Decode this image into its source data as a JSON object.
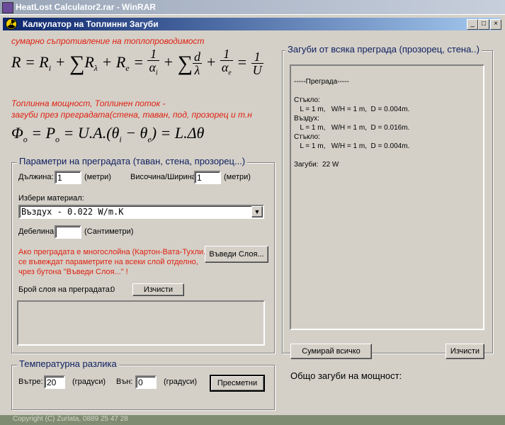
{
  "outer_window": {
    "title": "HeatLost Calculator2.rar - WinRAR"
  },
  "window": {
    "title": "Калкулатор на Топлинни Загуби",
    "min_label": "_",
    "max_label": "□",
    "close_label": "×"
  },
  "header": {
    "resistance_note": "сумарно съпротивление на топлопроводимост",
    "power_note_1": "Топлинна мощност, Топлинен поток -",
    "power_note_2": "загуби през преградата(стена, таван, под, прозорец и т.н"
  },
  "formula1": {
    "lhs": "R = R",
    "sub_i": "i",
    "plus1": " + ",
    "sum": "∑",
    "r_lambda": "R",
    "sub_lambda": "λ",
    "plus2": " + R",
    "sub_e": "e",
    "eq": " = ",
    "f1_num": "1",
    "f1_den": "α",
    "f1_den_sub": "i",
    "plus3": " + ",
    "sum2": "∑",
    "f2_num": "d",
    "f2_den": "λ",
    "plus4": " + ",
    "f3_num": "1",
    "f3_den": "α",
    "f3_den_sub": "e",
    "eq2": " = ",
    "f4_num": "1",
    "f4_den": "U"
  },
  "formula2": {
    "text": "Φ",
    "sub_o": "o",
    "mid": " = P",
    "sub_o2": "o",
    "rest": " = U.A.(θ",
    "sub_i": "i",
    "minus": " − θ",
    "sub_e": "e",
    "end": ") = L.Δθ"
  },
  "params": {
    "legend": "Параметри на преградата (таван, стена, прозорец...)",
    "length_label": "Дължина:",
    "length_value": "1",
    "length_unit": "(метри)",
    "height_label": "Височина/Ширина:",
    "height_value": "1",
    "height_unit": "(метри)",
    "material_label": "Избери материал:",
    "material_value": "Въздух                    - 0.022 W/m.K",
    "thickness_label": "Дебелина:",
    "thickness_value": "",
    "thickness_unit": "(Сантиметри)",
    "multilayer_note_1": "Ако преградата е многослойна (Картон-Вата-Тухли...)",
    "multilayer_note_2": "се въвеждат параметрите на всеки слой  отделно,",
    "multilayer_note_3": "чрез бутона \"Въведи Слоя...\" !",
    "enter_layer_button": "Въведи Слоя...",
    "layer_count_label": "Брой слоя на преградата:",
    "layer_count_value": "0",
    "clear_button": "Изчисти"
  },
  "temperature": {
    "legend": "Температурна разлика",
    "inside_label": "Вътре:",
    "inside_value": "20",
    "inside_unit": "(градуси)",
    "outside_label": "Вън:",
    "outside_value": "0",
    "outside_unit": "(градуси)",
    "calculate_button": "Пресметни"
  },
  "losses": {
    "legend": "Загуби от всяка преграда (прозорец, стена..)",
    "lines": [
      "-----Преграда-----",
      "",
      "Стъкло:",
      "   L = 1 m,   W/H = 1 m,  D = 0.004m.",
      "Въздух:",
      "   L = 1 m,   W/H = 1 m,  D = 0.016m.",
      "Стъкло:",
      "   L = 1 m,   W/H = 1 m,  D = 0.004m.",
      "",
      "Загуби:  22 W"
    ],
    "sum_button": "Сумирай всичко",
    "clear_button": "Изчисти",
    "total_label": "Общо загуби на мощност:"
  },
  "footer": {
    "copyright": "Copyright (C)  Zurlata,    0889 25 47 28"
  }
}
